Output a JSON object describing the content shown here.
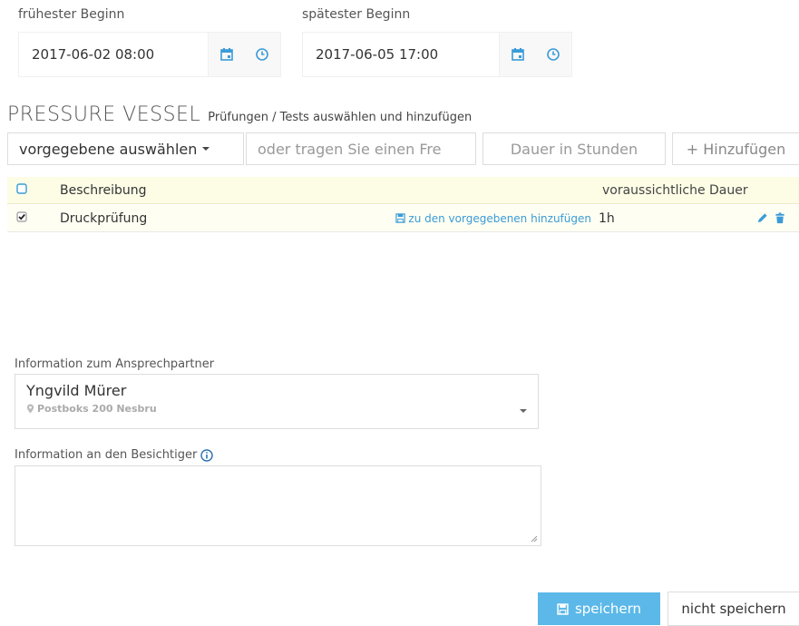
{
  "dates": {
    "earliest_label": "frühester Beginn",
    "earliest_value": "2017-06-02 08:00",
    "latest_label": "spätester Beginn",
    "latest_value": "2017-06-05 17:00"
  },
  "section": {
    "title": "PRESSURE VESSEL",
    "subtitle": "Prüfungen / Tests auswählen und hinzufügen"
  },
  "controls": {
    "select_label": "vorgegebene auswählen",
    "free_text_placeholder": "oder tragen Sie einen Fre",
    "duration_placeholder": "Dauer in Stunden",
    "add_label": "+ Hinzufügen"
  },
  "table": {
    "headers": {
      "description": "Beschreibung",
      "duration": "voraussichtliche Dauer"
    },
    "rows": [
      {
        "checked": true,
        "description": "Druckprüfung",
        "action": "zu den vorgegebenen hinzufügen",
        "duration": "1h"
      }
    ]
  },
  "contact": {
    "label": "Information zum Ansprechpartner",
    "name": "Yngvild Mürer",
    "address": "Postboks 200 Nesbru"
  },
  "inspector": {
    "label": "Information an den Besichtiger"
  },
  "actions": {
    "save": "speichern",
    "cancel": "nicht speichern"
  },
  "colors": {
    "accent": "#3a9bd8",
    "save_bg": "#5bb8e8",
    "table_bg": "#fdfde6"
  }
}
